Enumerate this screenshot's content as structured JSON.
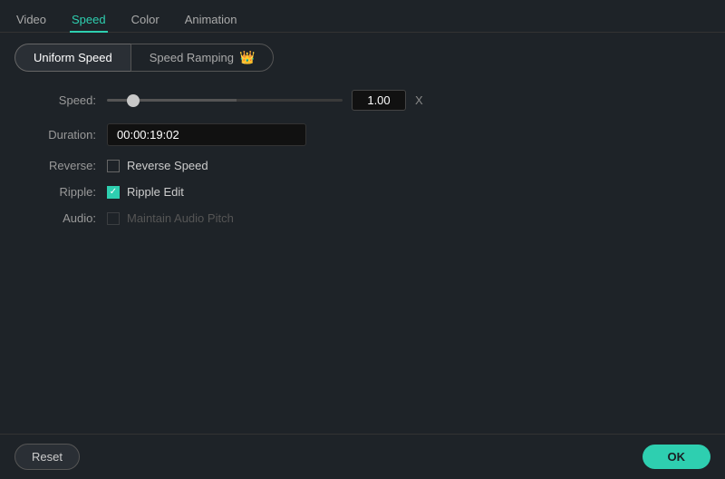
{
  "nav": {
    "tabs": [
      {
        "id": "video",
        "label": "Video",
        "active": false
      },
      {
        "id": "speed",
        "label": "Speed",
        "active": true
      },
      {
        "id": "color",
        "label": "Color",
        "active": false
      },
      {
        "id": "animation",
        "label": "Animation",
        "active": false
      }
    ]
  },
  "mode": {
    "uniform_label": "Uniform Speed",
    "ramping_label": "Speed Ramping",
    "active": "uniform"
  },
  "form": {
    "speed_label": "Speed:",
    "speed_value": "1.00",
    "speed_x": "X",
    "duration_label": "Duration:",
    "duration_value": "00:00:19:02",
    "reverse_label": "Reverse:",
    "reverse_checkbox_label": "Reverse Speed",
    "reverse_checked": false,
    "ripple_label": "Ripple:",
    "ripple_checkbox_label": "Ripple Edit",
    "ripple_checked": true,
    "audio_label": "Audio:",
    "audio_checkbox_label": "Maintain Audio Pitch",
    "audio_disabled": true
  },
  "footer": {
    "reset_label": "Reset",
    "ok_label": "OK"
  },
  "colors": {
    "accent": "#2ecfb0"
  }
}
